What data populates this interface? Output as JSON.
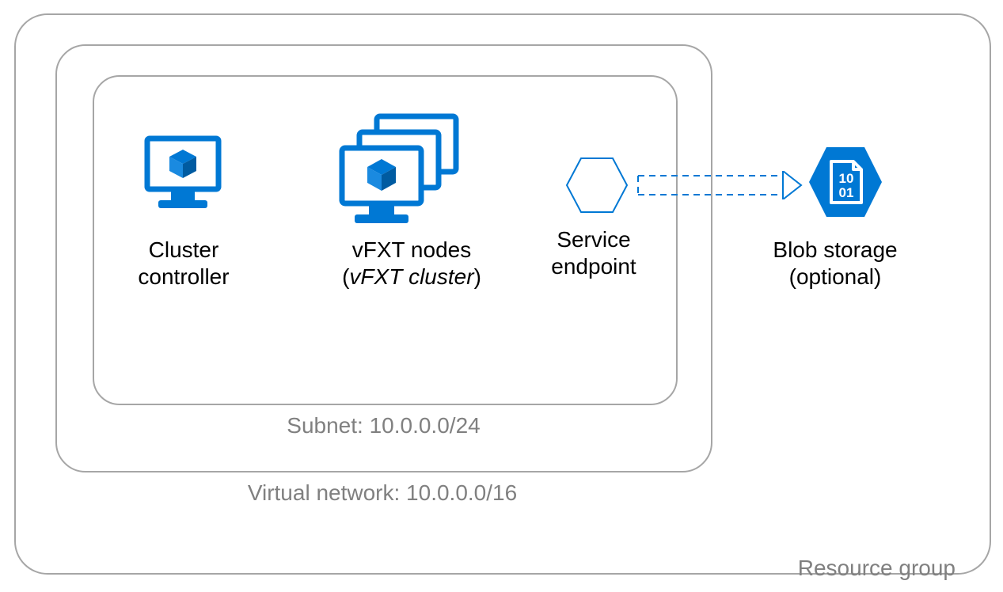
{
  "colors": {
    "border_gray": "#a6a6a6",
    "label_gray": "#808080",
    "azure_blue": "#0078d4"
  },
  "containers": {
    "resource_group_label": "Resource group",
    "vnet_label": "Virtual network: 10.0.0.0/16",
    "subnet_label": "Subnet: 10.0.0.0/24"
  },
  "components": {
    "cluster_controller": {
      "line1": "Cluster",
      "line2": "controller",
      "icon_name": "vm-icon"
    },
    "vfxt_nodes": {
      "line1": "vFXT nodes",
      "line2_prefix": "(",
      "line2_italic": "vFXT cluster",
      "line2_suffix": ")",
      "icon_name": "vm-cluster-icon"
    },
    "service_endpoint": {
      "line1": "Service",
      "line2": "endpoint",
      "icon_name": "hexagon-outline-icon"
    },
    "blob_storage": {
      "line1": "Blob storage",
      "line2": "(optional)",
      "icon_name": "blob-storage-icon",
      "binary_top": "10",
      "binary_bottom": "01"
    }
  },
  "connection": {
    "arrow_name": "dashed-arrow-icon"
  }
}
